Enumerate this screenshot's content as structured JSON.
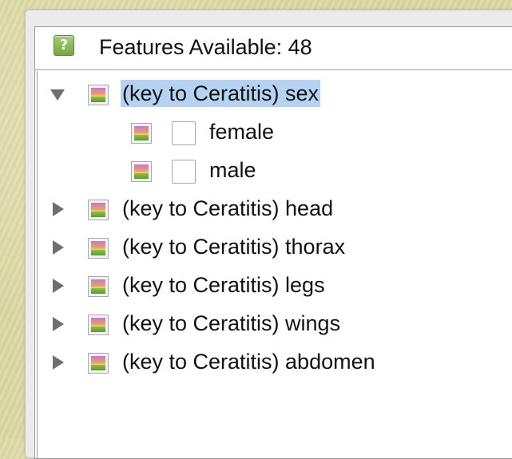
{
  "header": {
    "help_icon_glyph": "?",
    "title": "Features Available: 48"
  },
  "tree": {
    "items": [
      {
        "label": "(key to Ceratitis) sex",
        "expanded": true,
        "selected": true,
        "children": [
          {
            "label": "female",
            "checked": false
          },
          {
            "label": "male",
            "checked": false
          }
        ]
      },
      {
        "label": "(key to Ceratitis) head",
        "expanded": false,
        "selected": false
      },
      {
        "label": "(key to Ceratitis) thorax",
        "expanded": false,
        "selected": false
      },
      {
        "label": "(key to Ceratitis) legs",
        "expanded": false,
        "selected": false
      },
      {
        "label": "(key to Ceratitis) wings",
        "expanded": false,
        "selected": false
      },
      {
        "label": "(key to Ceratitis) abdomen",
        "expanded": false,
        "selected": false
      }
    ]
  },
  "colors": {
    "selection": "#b5d2f3",
    "help_icon": "#8cbc5c",
    "panel_border": "#7fa6cf"
  },
  "icons": {
    "help": "help-icon",
    "expand": "triangle-collapsed-icon",
    "collapse": "triangle-expanded-icon",
    "feature": "image-thumbnail-icon"
  }
}
